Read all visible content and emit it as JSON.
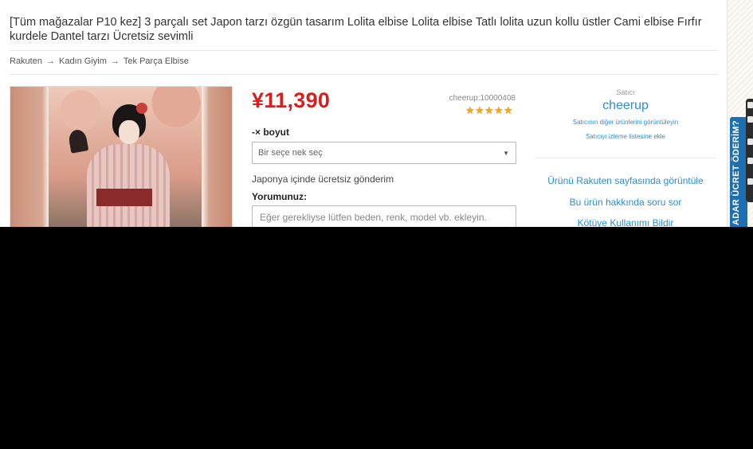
{
  "product": {
    "title": "[Tüm mağazalar P10 kez] 3 parçalı set Japon tarzı özgün tasarım Lolita elbise Lolita elbise Tatlı lolita uzun kollu üstler Cami elbise Fırfır kurdele Dantel tarzı Ücretsiz sevimli"
  },
  "breadcrumb": [
    {
      "label": "Rakuten"
    },
    {
      "label": "Kadın Giyim"
    },
    {
      "label": "Tek Parça Elbise"
    }
  ],
  "breadcrumb_separator": "→",
  "purchase": {
    "price": "¥11,390",
    "shop_code": "cheerup:10000408",
    "rating_stars": 5,
    "size_label": "-× boyut",
    "size_select_value": "Bir seçe nek seç",
    "shipping_note": "Japonya içinde ücretsiz gönderim",
    "comment_label": "Yorumunuz:",
    "comment_placeholder": "Eğer gerekliyse lütfen beden, renk, model vb. ekleyin."
  },
  "seller": {
    "caption": "Satıcı",
    "name": "cheerup",
    "other_products_link": "Satıcının diğer ürünlerini görüntüleyin",
    "watchlist_link": "Satıcıyı izleme listesine ekle"
  },
  "actions": {
    "view_on_rakuten": "Ürünü Rakuten sayfasında görüntüle",
    "ask_question": "Bu ürün hakkında soru sor",
    "report_abuse": "Kötüye Kullanımı Bildir"
  },
  "side_tab": {
    "label": "ADAR ÜCRET ÖDERİM?"
  },
  "colors": {
    "price": "#d6201f",
    "link": "#2b8ed6",
    "side_tab": "#1d6fb3",
    "star": "#f2a91b"
  }
}
